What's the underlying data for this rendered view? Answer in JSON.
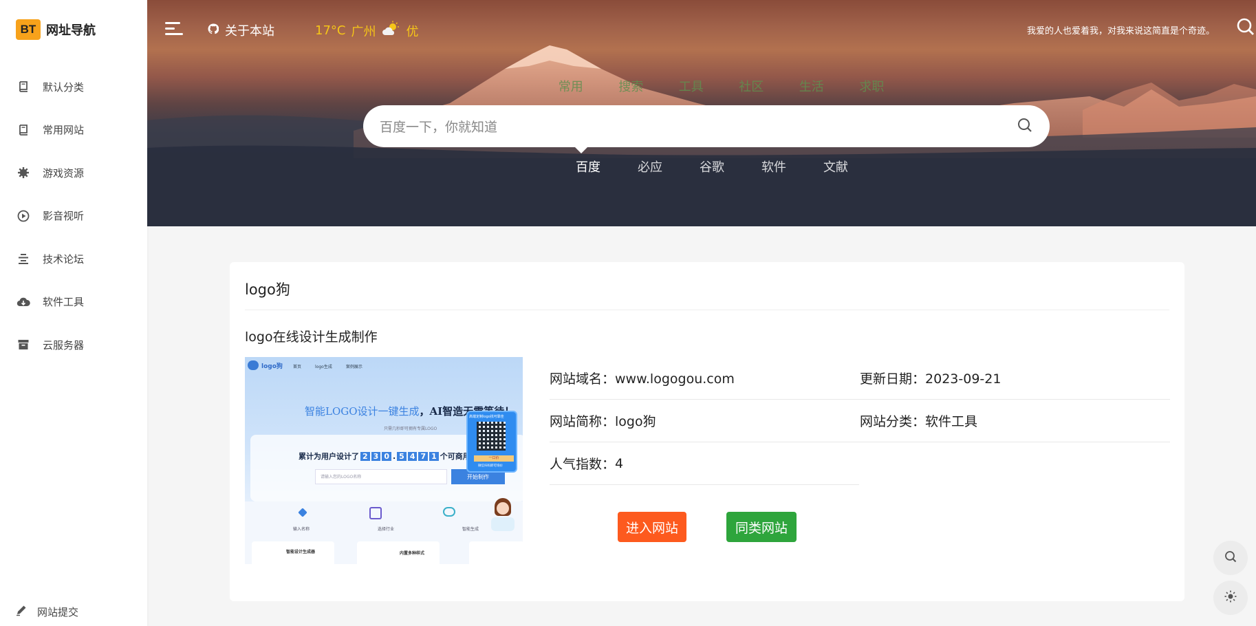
{
  "brand": {
    "badge": "BT",
    "name": "网址导航"
  },
  "sidebar": {
    "items": [
      {
        "label": "默认分类",
        "icon": "book-icon"
      },
      {
        "label": "常用网站",
        "icon": "book-icon"
      },
      {
        "label": "游戏资源",
        "icon": "gear-icon"
      },
      {
        "label": "影音视听",
        "icon": "play-icon"
      },
      {
        "label": "技术论坛",
        "icon": "bars-icon"
      },
      {
        "label": "软件工具",
        "icon": "cloud-download-icon"
      },
      {
        "label": "云服务器",
        "icon": "archive-icon"
      }
    ],
    "submit_label": "网站提交"
  },
  "header": {
    "about_label": "关于本站",
    "weather": {
      "temp": "17°C",
      "city": "广州",
      "quality": "优"
    },
    "motto": "我爱的人也爱着我，对我来说这简直是个奇迹。",
    "categories": [
      "常用",
      "搜索",
      "工具",
      "社区",
      "生活",
      "求职"
    ],
    "search_placeholder": "百度一下，你就知道",
    "engines": [
      "百度",
      "必应",
      "谷歌",
      "软件",
      "文献"
    ],
    "active_engine": "百度"
  },
  "site": {
    "title": "logo狗",
    "description": "logo在线设计生成制作",
    "domain_label": "网站域名：",
    "domain": "www.logogou.com",
    "updated_label": "更新日期：",
    "updated": "2023-09-21",
    "short_label": "网站简称：",
    "short": "logo狗",
    "category_label": "网站分类：",
    "category": "软件工具",
    "popularity_label": "人气指数：",
    "popularity": "4",
    "enter_label": "进入网站",
    "similar_label": "同类网站"
  },
  "preview": {
    "logo_text": "logo狗",
    "nav": [
      "首页",
      "logo生成",
      "案例展示"
    ],
    "headline_a": "智能LOGO设计一键生成",
    "headline_b": "，AI智造无需等待！",
    "subline": "只需几秒即可拥有专属LOGO",
    "counter_prefix": "累计为用户设计了",
    "counter_digits": [
      "2",
      "3",
      "0",
      ".",
      "5",
      "4",
      "7",
      "1"
    ],
    "counter_suffix": "个可商用LOGO",
    "input_placeholder": "请输入您的LOGO名称",
    "start_label": "开始制作",
    "steps": [
      "输入名称",
      "选择行业",
      "智能生成"
    ],
    "qr_title": "高端定制logo找可靠佳",
    "qr_button": "一口价",
    "qr_note": "微信扫码即可询价",
    "features": [
      "智能设计生成器",
      "内置多种样式"
    ]
  },
  "colors": {
    "accent": "#f7a21b",
    "enter": "#fd5a1e",
    "similar": "#2ea53c",
    "weather": "#f5c518"
  }
}
